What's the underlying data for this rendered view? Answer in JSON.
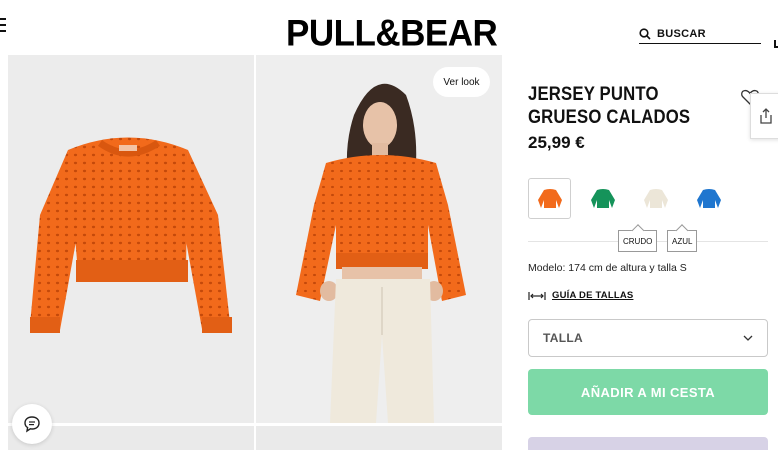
{
  "brand": {
    "logo_text": "PULL&BEAR"
  },
  "header": {
    "search_label": "BUSCAR",
    "search_icon": "search-icon",
    "menu_icon": "hamburger-menu-icon"
  },
  "gallery": {
    "ver_look_label": "Ver look",
    "chat_icon": "chat-icon"
  },
  "product": {
    "name": "JERSEY PUNTO GRUESO CALADOS",
    "price": "25,99 €",
    "colors": [
      {
        "name": "Naranja",
        "hex": "#f26a1b",
        "selected": true
      },
      {
        "name": "Verde",
        "hex": "#15935a",
        "selected": false
      },
      {
        "name": "CRUDO",
        "hex": "#ece6d8",
        "selected": false
      },
      {
        "name": "AZUL",
        "hex": "#1f76cf",
        "selected": false
      }
    ],
    "color_tooltips": [
      "CRUDO",
      "AZUL"
    ],
    "model_info": "Modelo: 174 cm de altura y talla S",
    "size_guide_label": "GUÍA DE TALLAS",
    "size_select_label": "TALLA",
    "add_to_cart_label": "AÑADIR A MI CESTA"
  },
  "colors": {
    "accent_green": "#7dd9a7",
    "sweater_orange": "#f26a1b",
    "bottom_bar": "#d7d2e6"
  }
}
